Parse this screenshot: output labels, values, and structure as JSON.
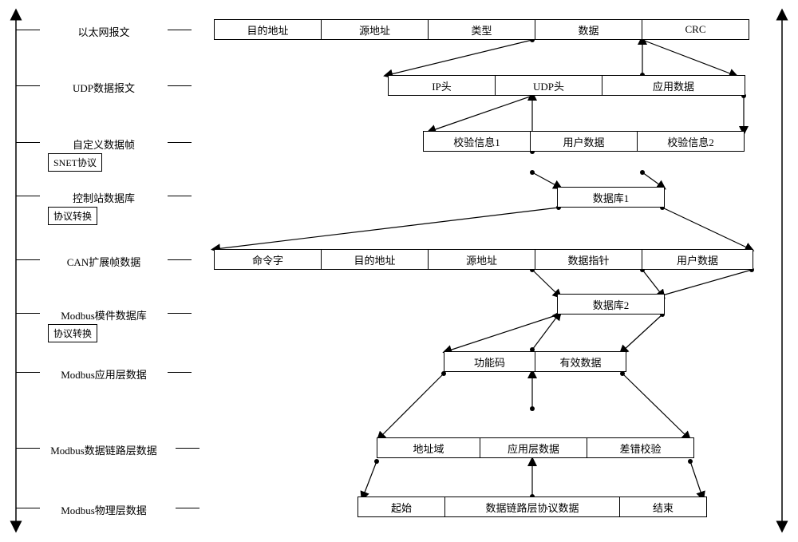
{
  "rows": [
    {
      "label": "以太网报文",
      "tag": ""
    },
    {
      "label": "UDP数据报文",
      "tag": ""
    },
    {
      "label": "自定义数据帧",
      "tag": "SNET协议"
    },
    {
      "label": "控制站数据库",
      "tag": "协议转换"
    },
    {
      "label": "CAN扩展帧数据",
      "tag": ""
    },
    {
      "label": "Modbus模件数据库",
      "tag": "协议转换"
    },
    {
      "label": "Modbus应用层数据",
      "tag": ""
    },
    {
      "label": "Modbus数据链路层数据",
      "tag": ""
    },
    {
      "label": "Modbus物理层数据",
      "tag": ""
    }
  ],
  "cells": {
    "r0": [
      "目的地址",
      "源地址",
      "类型",
      "数据",
      "CRC"
    ],
    "r1": [
      "IP头",
      "UDP头",
      "应用数据"
    ],
    "r2": [
      "校验信息1",
      "用户数据",
      "校验信息2"
    ],
    "r3": [
      "数据库1"
    ],
    "r4": [
      "命令字",
      "目的地址",
      "源地址",
      "数据指针",
      "用户数据"
    ],
    "r5": [
      "数据库2"
    ],
    "r6": [
      "功能码",
      "有效数据"
    ],
    "r7": [
      "地址域",
      "应用层数据",
      "差错校验"
    ],
    "r8": [
      "起始",
      "数据链路层协议数据",
      "结束"
    ]
  }
}
